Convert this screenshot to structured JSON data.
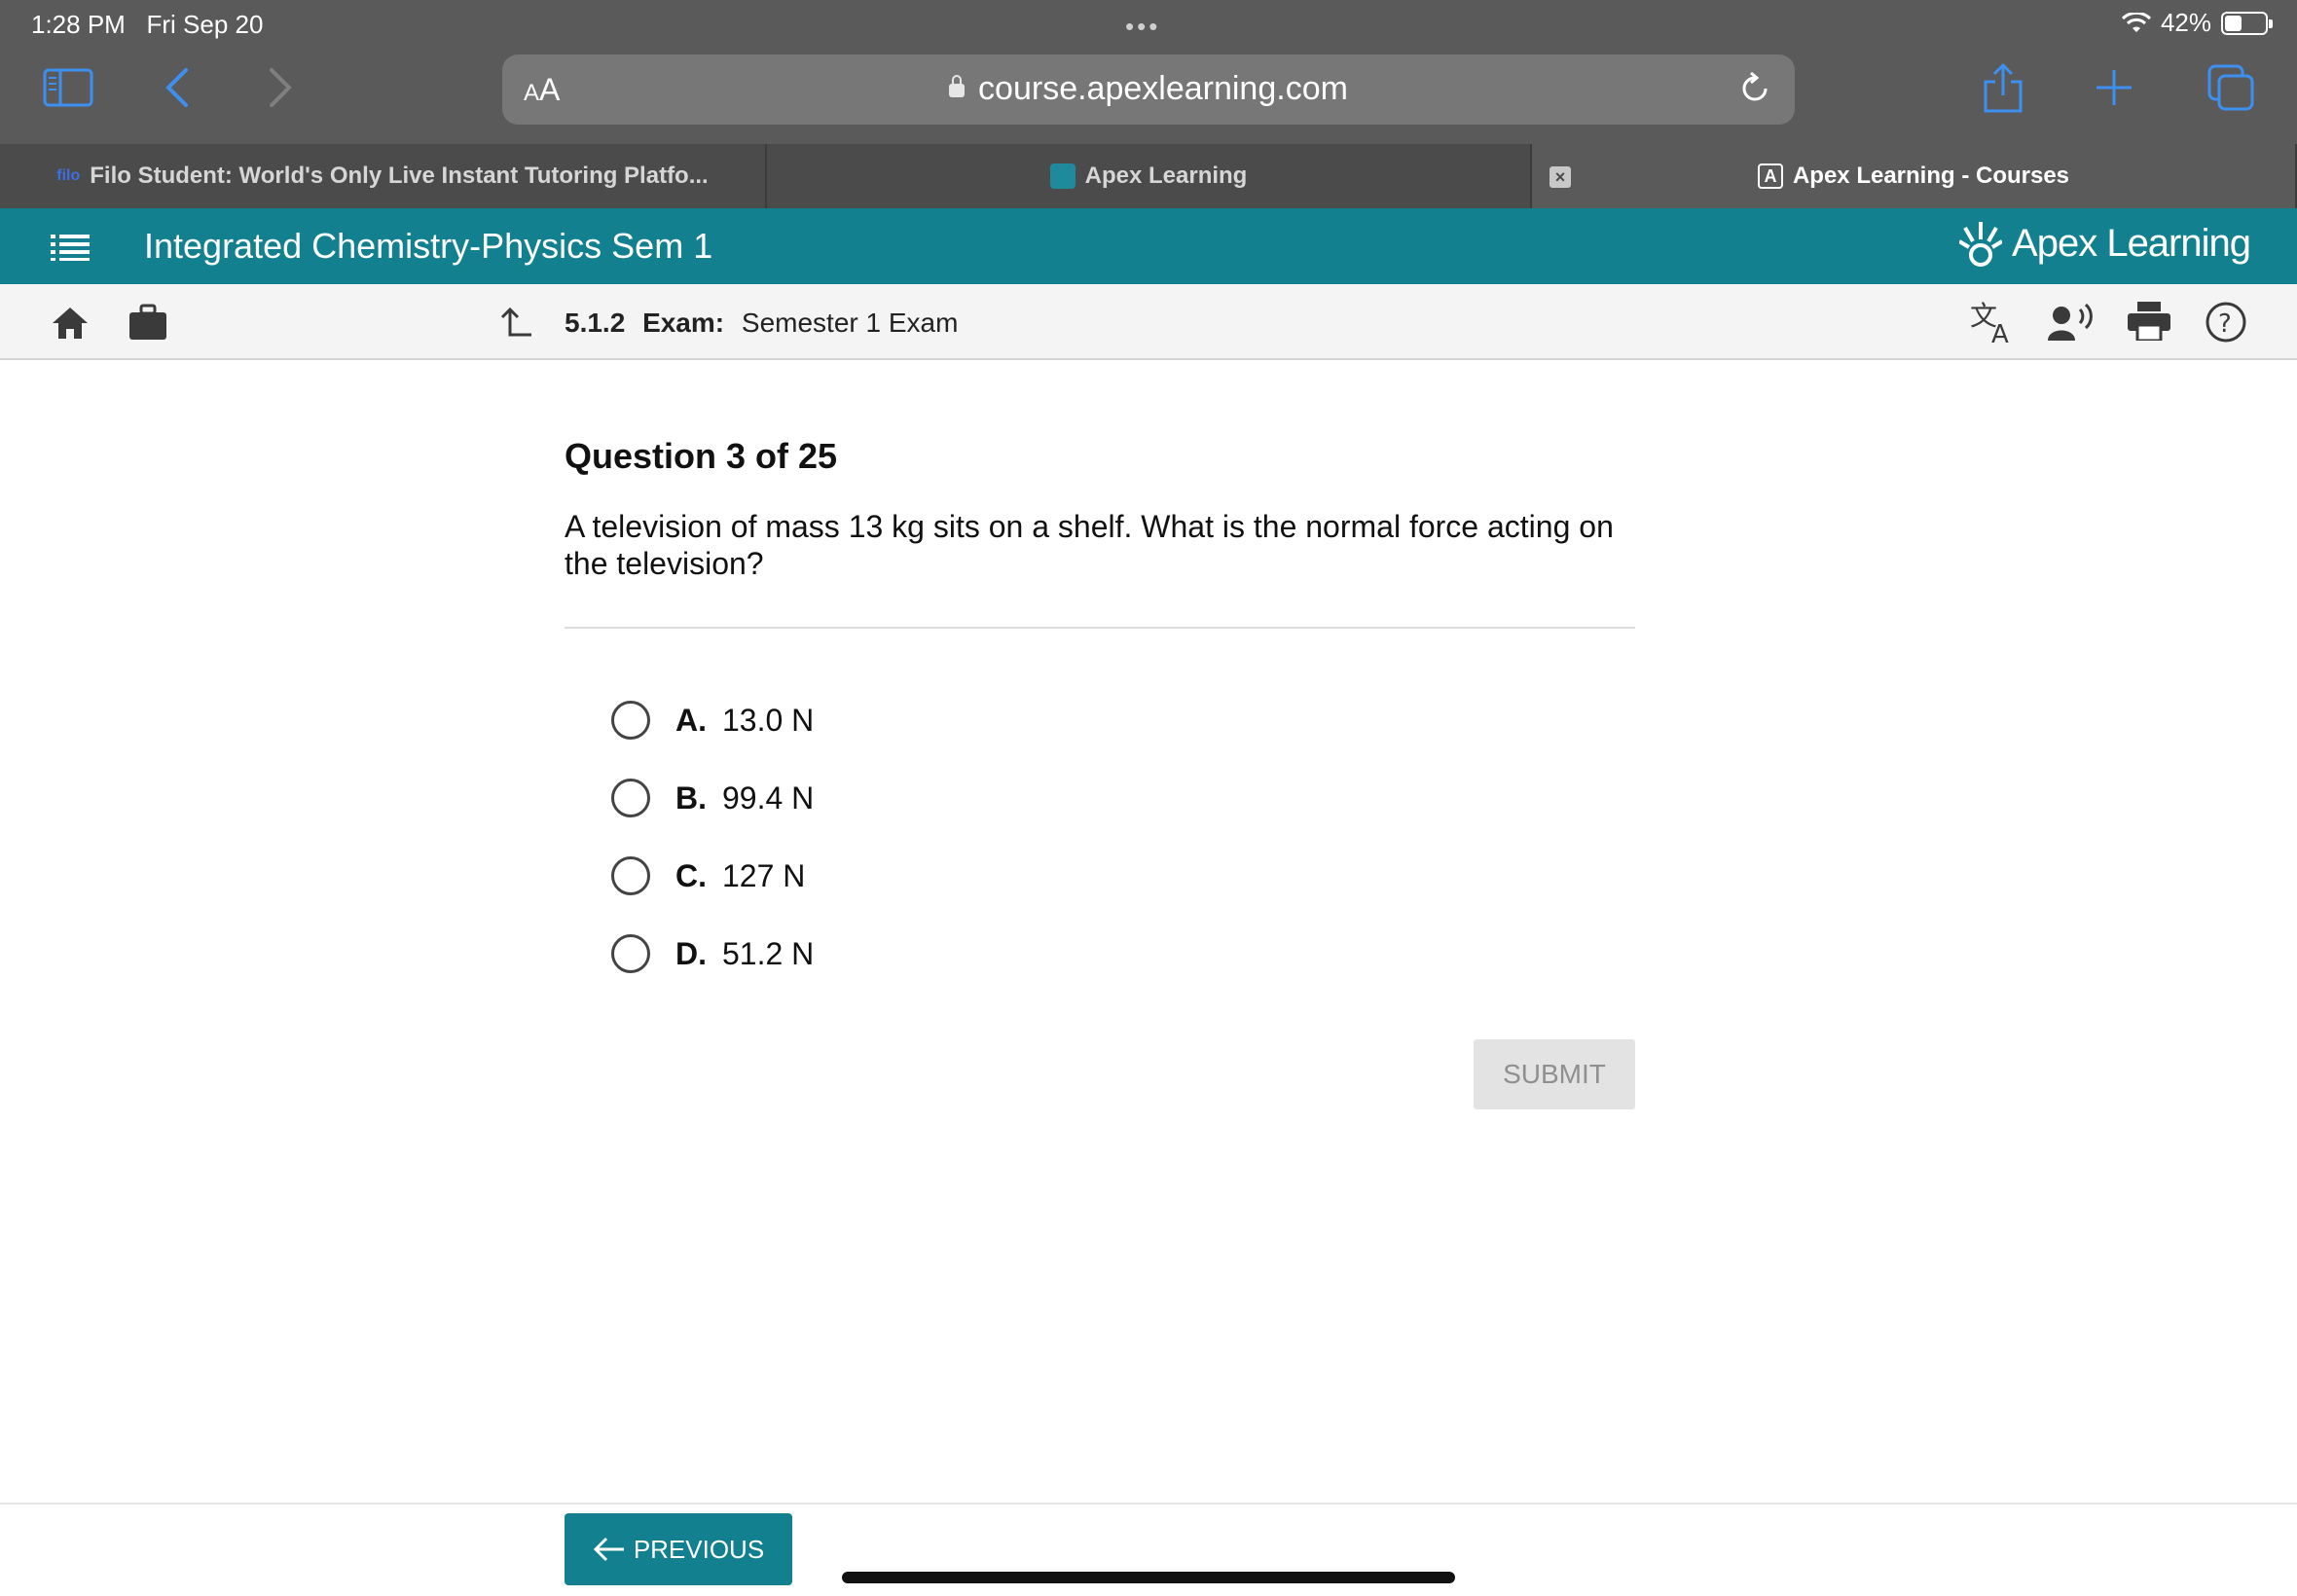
{
  "status_bar": {
    "time": "1:28 PM",
    "date": "Fri Sep 20",
    "dots": "•••",
    "battery": "42%"
  },
  "browser": {
    "text_size_label": "AA",
    "url": "course.apexlearning.com",
    "tabs": [
      {
        "favicon": "filo",
        "label": "Filo Student: World's Only Live Instant Tutoring Platfo..."
      },
      {
        "favicon": "apex",
        "label": "Apex Learning"
      },
      {
        "favicon": "A",
        "label": "Apex Learning - Courses"
      }
    ],
    "icons": [
      "sidebar-icon",
      "back-icon",
      "forward-icon",
      "reload-icon",
      "share-icon",
      "new-tab-icon",
      "tabs-icon"
    ]
  },
  "header": {
    "course_title": "Integrated Chemistry-Physics Sem 1",
    "brand": "Apex Learning",
    "brand_color": "#12808f"
  },
  "subbar": {
    "section": "5.1.2",
    "type_label": "Exam:",
    "title": "Semester 1 Exam"
  },
  "question": {
    "heading": "Question 3 of 25",
    "text": "A television of mass 13 kg sits on a shelf. What is the normal force acting on the television?",
    "options": [
      {
        "letter": "A.",
        "text": "13.0 N"
      },
      {
        "letter": "B.",
        "text": "99.4 N"
      },
      {
        "letter": "C.",
        "text": "127 N"
      },
      {
        "letter": "D.",
        "text": "51.2 N"
      }
    ],
    "submit_label": "SUBMIT"
  },
  "footer": {
    "previous_label": "PREVIOUS"
  }
}
